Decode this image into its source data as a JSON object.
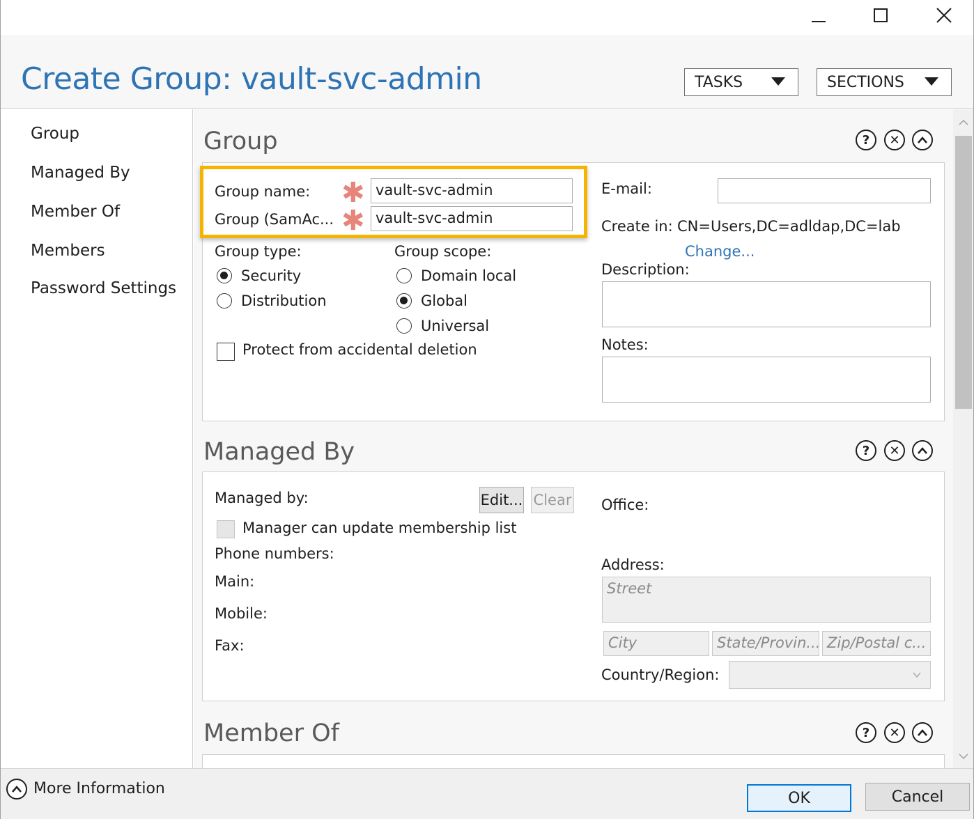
{
  "window": {
    "title": "Create Group: vault-svc-admin"
  },
  "header": {
    "tasks_label": "TASKS",
    "sections_label": "SECTIONS"
  },
  "sidebar": {
    "items": [
      {
        "label": "Group"
      },
      {
        "label": "Managed By"
      },
      {
        "label": "Member Of"
      },
      {
        "label": "Members"
      },
      {
        "label": "Password Settings"
      }
    ]
  },
  "group_section": {
    "title": "Group",
    "group_name_label": "Group name:",
    "group_name_value": "vault-svc-admin",
    "samaccount_label": "Group (SamAc...",
    "samaccount_value": "vault-svc-admin",
    "group_type_label": "Group type:",
    "group_type_options": [
      {
        "label": "Security",
        "selected": true
      },
      {
        "label": "Distribution",
        "selected": false
      }
    ],
    "group_scope_label": "Group scope:",
    "group_scope_options": [
      {
        "label": "Domain local",
        "selected": false
      },
      {
        "label": "Global",
        "selected": true
      },
      {
        "label": "Universal",
        "selected": false
      }
    ],
    "protect_label": "Protect from accidental deletion",
    "protect_checked": false,
    "email_label": "E-mail:",
    "email_value": "",
    "create_in_label": "Create in:",
    "create_in_value": "CN=Users,DC=adldap,DC=lab",
    "change_link": "Change...",
    "description_label": "Description:",
    "notes_label": "Notes:"
  },
  "managed_by_section": {
    "title": "Managed By",
    "managed_by_label": "Managed by:",
    "edit_button": "Edit...",
    "clear_button": "Clear",
    "manager_update_label": "Manager can update membership list",
    "phone_numbers_label": "Phone numbers:",
    "main_label": "Main:",
    "mobile_label": "Mobile:",
    "fax_label": "Fax:",
    "office_label": "Office:",
    "address_label": "Address:",
    "street_placeholder": "Street",
    "city_placeholder": "City",
    "state_placeholder": "State/Provin...",
    "zip_placeholder": "Zip/Postal c...",
    "country_label": "Country/Region:"
  },
  "member_of_section": {
    "title": "Member Of"
  },
  "footer": {
    "more_info_label": "More Information",
    "ok_label": "OK",
    "cancel_label": "Cancel"
  },
  "colors": {
    "title_blue": "#2e74b5",
    "highlight": "#f5b400",
    "required_star": "#e8857a"
  }
}
